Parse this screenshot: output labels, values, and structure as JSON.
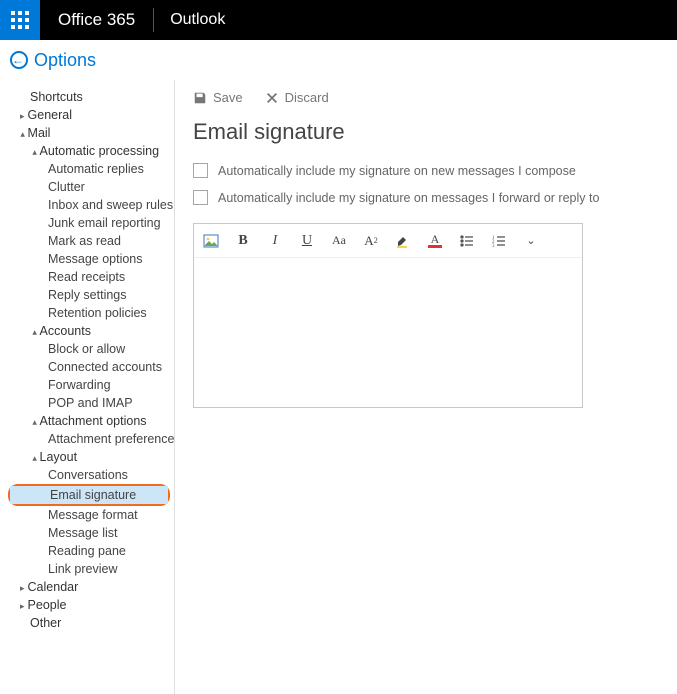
{
  "header": {
    "brand": "Office 365",
    "app": "Outlook"
  },
  "back": {
    "label": "Options"
  },
  "sidebar": {
    "shortcuts": "Shortcuts",
    "general": "General",
    "mail": "Mail",
    "autoproc": "Automatic processing",
    "autoreplies": "Automatic replies",
    "clutter": "Clutter",
    "inbox_sweep": "Inbox and sweep rules",
    "junk": "Junk email reporting",
    "markread": "Mark as read",
    "msgopts": "Message options",
    "readrec": "Read receipts",
    "replyset": "Reply settings",
    "retention": "Retention policies",
    "accounts": "Accounts",
    "block": "Block or allow",
    "connected": "Connected accounts",
    "forwarding": "Forwarding",
    "popimap": "POP and IMAP",
    "attachopts": "Attachment options",
    "attachprefs": "Attachment preferences",
    "layout": "Layout",
    "conversations": "Conversations",
    "emailsig": "Email signature",
    "msgformat": "Message format",
    "msglist": "Message list",
    "readingpane": "Reading pane",
    "linkpreview": "Link preview",
    "calendar": "Calendar",
    "people": "People",
    "other": "Other"
  },
  "content": {
    "save": "Save",
    "discard": "Discard",
    "title": "Email signature",
    "chk1": "Automatically include my signature on new messages I compose",
    "chk2": "Automatically include my signature on messages I forward or reply to"
  },
  "toolbar_icons": {
    "image": "image-icon",
    "bold": "B",
    "italic": "I",
    "underline": "U",
    "fontsize": "Aa",
    "super": "A",
    "highlight_letter": "A",
    "fontcolor_letter": "A"
  }
}
